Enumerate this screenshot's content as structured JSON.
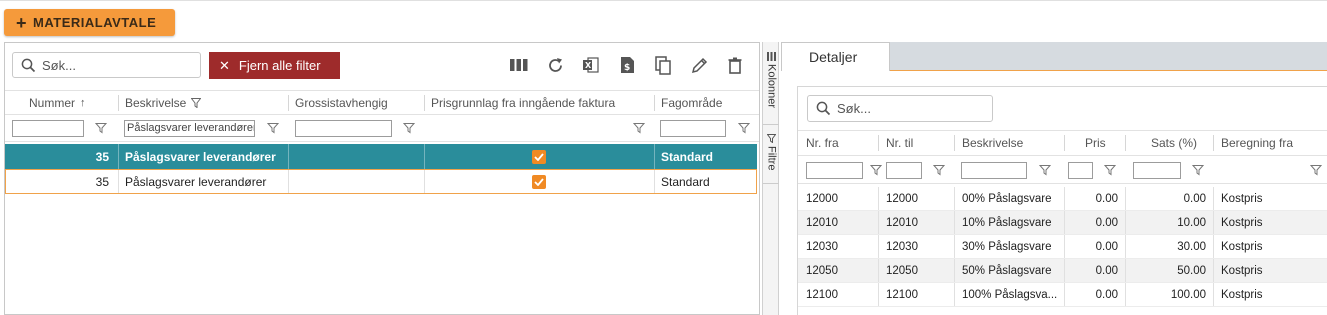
{
  "toolbar": {
    "add_label": "MATERIALAVTALE"
  },
  "left": {
    "search_placeholder": "Søk...",
    "clear_filter_label": "Fjern alle  filter",
    "columns": [
      "Nummer",
      "Beskrivelse",
      "Grossistavhengig",
      "Prisgrunnlag fra inngående faktura",
      "Fagområde"
    ],
    "sort_indicator": "↑",
    "filter_value_description": "Påslagsvarer leverandører",
    "rows": [
      {
        "nummer": "35",
        "beskrivelse": "Påslagsvarer leverandører",
        "grossist": "",
        "prisgrunnlag": true,
        "fagomrade": "Standard",
        "selected": true
      },
      {
        "nummer": "35",
        "beskrivelse": "Påslagsvarer leverandører",
        "grossist": "",
        "prisgrunnlag": true,
        "fagomrade": "Standard",
        "selected": false
      }
    ]
  },
  "sidetabs": {
    "columns_label": "Kolonner",
    "filters_label": "Filtre"
  },
  "right": {
    "tab_label": "Detaljer",
    "search_placeholder": "Søk...",
    "columns": [
      "Nr. fra",
      "Nr. til",
      "Beskrivelse",
      "Pris",
      "Sats (%)",
      "Beregning fra"
    ],
    "rows": [
      {
        "fra": "12000",
        "til": "12000",
        "beskrivelse": "00% Påslagsvare",
        "pris": "0.00",
        "sats": "0.00",
        "beregning": "Kostpris"
      },
      {
        "fra": "12010",
        "til": "12010",
        "beskrivelse": "10% Påslagsvare",
        "pris": "0.00",
        "sats": "10.00",
        "beregning": "Kostpris"
      },
      {
        "fra": "12030",
        "til": "12030",
        "beskrivelse": "30% Påslagsvare",
        "pris": "0.00",
        "sats": "30.00",
        "beregning": "Kostpris"
      },
      {
        "fra": "12050",
        "til": "12050",
        "beskrivelse": "50% Påslagsvare",
        "pris": "0.00",
        "sats": "50.00",
        "beregning": "Kostpris"
      },
      {
        "fra": "12100",
        "til": "12100",
        "beskrivelse": "100% Påslagsva...",
        "pris": "0.00",
        "sats": "100.00",
        "beregning": "Kostpris"
      }
    ]
  },
  "colors": {
    "accent": "#f59a3b",
    "selected_row": "#2a8d9b",
    "danger": "#9e2b2b",
    "checkbox": "#f08a24"
  }
}
